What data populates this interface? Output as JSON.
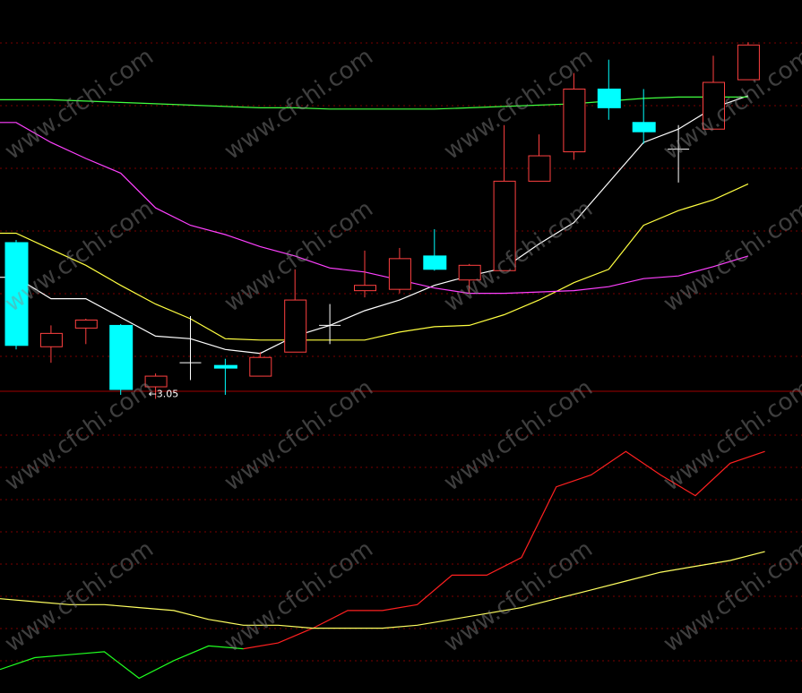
{
  "watermark": "www.cfchi.com",
  "colors": {
    "background": "#000000",
    "up": "#ff4040",
    "down": "#00ffff",
    "ma_white": "#ffffff",
    "ma_yellow": "#ffff40",
    "ma_magenta": "#ff40ff",
    "ma_green": "#40ff40",
    "divider": "#a00000",
    "grid": "#7a0000",
    "osc_red": "#ff2020",
    "osc_green": "#20ff20",
    "osc_yellow": "#ffff60"
  },
  "chart_data": [
    {
      "type": "candlestick",
      "ylim": [
        3.0,
        5.85
      ],
      "annotation": {
        "text": "←3.05",
        "index": 4,
        "value": 3.05
      },
      "candles": [
        {
          "o": 4.1,
          "h": 4.12,
          "l": 3.3,
          "c": 3.33
        },
        {
          "o": 3.32,
          "h": 3.48,
          "l": 3.2,
          "c": 3.42
        },
        {
          "o": 3.46,
          "h": 3.53,
          "l": 3.34,
          "c": 3.52
        },
        {
          "o": 3.48,
          "h": 3.49,
          "l": 2.96,
          "c": 3.0
        },
        {
          "o": 3.02,
          "h": 3.12,
          "l": 2.93,
          "c": 3.1
        },
        {
          "o": 3.2,
          "h": 3.55,
          "l": 3.07,
          "c": 3.2
        },
        {
          "o": 3.18,
          "h": 3.23,
          "l": 2.96,
          "c": 3.16
        },
        {
          "o": 3.1,
          "h": 3.28,
          "l": 3.1,
          "c": 3.24
        },
        {
          "o": 3.28,
          "h": 3.9,
          "l": 3.28,
          "c": 3.67
        },
        {
          "o": 3.48,
          "h": 3.64,
          "l": 3.34,
          "c": 3.48
        },
        {
          "o": 3.74,
          "h": 4.04,
          "l": 3.69,
          "c": 3.78
        },
        {
          "o": 3.75,
          "h": 4.06,
          "l": 3.72,
          "c": 3.98
        },
        {
          "o": 4.0,
          "h": 4.2,
          "l": 3.89,
          "c": 3.9
        },
        {
          "o": 3.82,
          "h": 3.94,
          "l": 3.72,
          "c": 3.93
        },
        {
          "o": 3.89,
          "h": 4.98,
          "l": 3.89,
          "c": 4.56
        },
        {
          "o": 4.56,
          "h": 4.91,
          "l": 4.56,
          "c": 4.75
        },
        {
          "o": 4.78,
          "h": 5.37,
          "l": 4.72,
          "c": 5.25
        },
        {
          "o": 5.25,
          "h": 5.47,
          "l": 5.02,
          "c": 5.11
        },
        {
          "o": 5.0,
          "h": 5.25,
          "l": 4.84,
          "c": 4.93
        },
        {
          "o": 4.8,
          "h": 4.98,
          "l": 4.55,
          "c": 4.78
        },
        {
          "o": 4.95,
          "h": 5.5,
          "l": 4.95,
          "c": 5.3
        },
        {
          "o": 5.32,
          "h": 5.6,
          "l": 5.32,
          "c": 5.58
        }
      ],
      "moving_averages": [
        {
          "color": "white",
          "values": [
            3.84,
            3.68,
            3.68,
            3.54,
            3.4,
            3.38,
            3.3,
            3.27,
            3.4,
            3.48,
            3.59,
            3.67,
            3.78,
            3.85,
            3.91,
            4.09,
            4.25,
            4.55,
            4.85,
            4.95,
            5.11,
            5.2
          ]
        },
        {
          "color": "yellow",
          "values": [
            4.17,
            4.05,
            3.93,
            3.78,
            3.64,
            3.53,
            3.38,
            3.37,
            3.37,
            3.37,
            3.37,
            3.43,
            3.47,
            3.48,
            3.56,
            3.67,
            3.8,
            3.9,
            4.23,
            4.34,
            4.42,
            4.54
          ]
        },
        {
          "color": "magenta",
          "values": [
            5.0,
            4.85,
            4.73,
            4.62,
            4.36,
            4.23,
            4.16,
            4.07,
            4.0,
            3.91,
            3.88,
            3.82,
            3.76,
            3.72,
            3.72,
            3.73,
            3.74,
            3.77,
            3.83,
            3.85,
            3.92,
            4.0
          ]
        },
        {
          "color": "green",
          "values": [
            5.17,
            5.17,
            5.16,
            5.15,
            5.14,
            5.13,
            5.12,
            5.11,
            5.11,
            5.1,
            5.1,
            5.1,
            5.1,
            5.11,
            5.12,
            5.13,
            5.14,
            5.16,
            5.18,
            5.19,
            5.19,
            5.19
          ]
        }
      ]
    },
    {
      "type": "line",
      "ylim": [
        0,
        100
      ],
      "series": [
        {
          "color": "green-red",
          "values": [
            8,
            12,
            13,
            14,
            5,
            11,
            16,
            15,
            17,
            22,
            28,
            28,
            30,
            40,
            40,
            46,
            70,
            74,
            82,
            74,
            67,
            78,
            82
          ]
        },
        {
          "color": "yellow",
          "values": [
            32,
            31,
            30,
            30,
            29,
            28,
            25,
            23,
            23,
            22,
            22,
            22,
            23,
            25,
            27,
            29,
            32,
            35,
            38,
            41,
            43,
            45,
            48
          ]
        }
      ],
      "red_from_index": 7
    }
  ]
}
